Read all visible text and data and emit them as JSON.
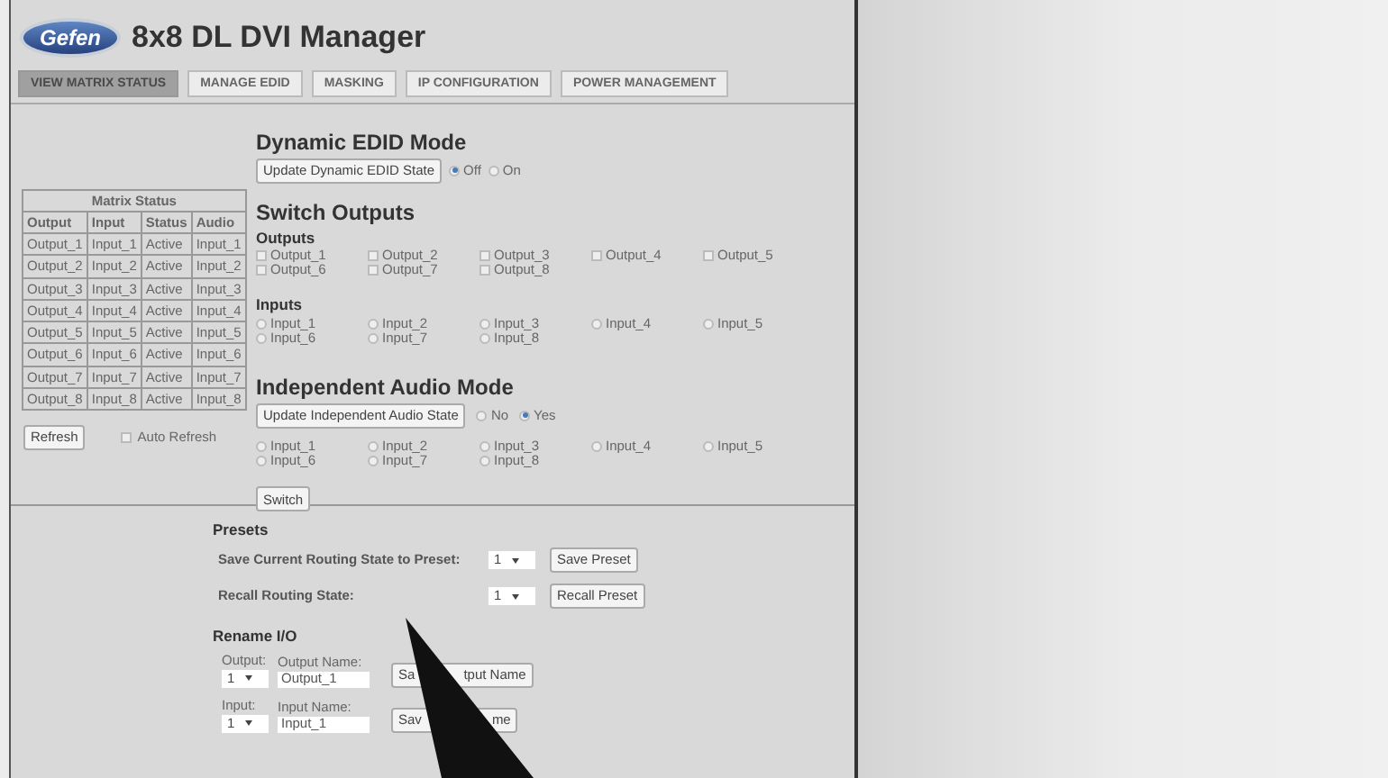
{
  "header": {
    "logo": "Gefen",
    "title": "8x8 DL DVI Manager"
  },
  "tabs": [
    {
      "label": "VIEW MATRIX STATUS",
      "selected": true
    },
    {
      "label": "MANAGE EDID",
      "selected": false
    },
    {
      "label": "MASKING",
      "selected": false
    },
    {
      "label": "IP CONFIGURATION",
      "selected": false
    },
    {
      "label": "POWER MANAGEMENT",
      "selected": false
    }
  ],
  "matrix": {
    "title": "Matrix Status",
    "columns": [
      "Output",
      "Input",
      "Status",
      "Audio"
    ],
    "rows": [
      [
        "Output_1",
        "Input_1",
        "Active",
        "Input_1"
      ],
      [
        "Output_2",
        "Input_2",
        "Active",
        "Input_2"
      ],
      [
        "Output_3",
        "Input_3",
        "Active",
        "Input_3"
      ],
      [
        "Output_4",
        "Input_4",
        "Active",
        "Input_4"
      ],
      [
        "Output_5",
        "Input_5",
        "Active",
        "Input_5"
      ],
      [
        "Output_6",
        "Input_6",
        "Active",
        "Input_6"
      ],
      [
        "Output_7",
        "Input_7",
        "Active",
        "Input_7"
      ],
      [
        "Output_8",
        "Input_8",
        "Active",
        "Input_8"
      ]
    ],
    "refresh": "Refresh",
    "auto_refresh": {
      "label": "Auto Refresh",
      "checked": false
    }
  },
  "dynamic_edid": {
    "heading": "Dynamic EDID Mode",
    "button": "Update Dynamic EDID State",
    "options": [
      {
        "label": "Off",
        "selected": true
      },
      {
        "label": "On",
        "selected": false
      }
    ]
  },
  "switch_outputs": {
    "heading": "Switch Outputs",
    "outputs": {
      "label": "Outputs",
      "items": [
        {
          "label": "Output_1",
          "checked": false
        },
        {
          "label": "Output_2",
          "checked": false
        },
        {
          "label": "Output_3",
          "checked": false
        },
        {
          "label": "Output_4",
          "checked": false
        },
        {
          "label": "Output_5",
          "checked": false
        },
        {
          "label": "Output_6",
          "checked": false
        },
        {
          "label": "Output_7",
          "checked": false
        },
        {
          "label": "Output_8",
          "checked": false
        }
      ]
    },
    "inputs": {
      "label": "Inputs",
      "items": [
        {
          "label": "Input_1",
          "selected": false
        },
        {
          "label": "Input_2",
          "selected": false
        },
        {
          "label": "Input_3",
          "selected": false
        },
        {
          "label": "Input_4",
          "selected": false
        },
        {
          "label": "Input_5",
          "selected": false
        },
        {
          "label": "Input_6",
          "selected": false
        },
        {
          "label": "Input_7",
          "selected": false
        },
        {
          "label": "Input_8",
          "selected": false
        }
      ]
    }
  },
  "audio": {
    "heading": "Independent Audio Mode",
    "button": "Update Independent Audio State",
    "options": [
      {
        "label": "No",
        "selected": false
      },
      {
        "label": "Yes",
        "selected": true
      }
    ],
    "inputs": [
      {
        "label": "Input_1",
        "selected": false
      },
      {
        "label": "Input_2",
        "selected": false
      },
      {
        "label": "Input_3",
        "selected": false
      },
      {
        "label": "Input_4",
        "selected": false
      },
      {
        "label": "Input_5",
        "selected": false
      },
      {
        "label": "Input_6",
        "selected": false
      },
      {
        "label": "Input_7",
        "selected": false
      },
      {
        "label": "Input_8",
        "selected": false
      }
    ],
    "switch": "Switch"
  },
  "presets": {
    "heading": "Presets",
    "save": {
      "label": "Save Current Routing State to Preset:",
      "value": "1",
      "button": "Save Preset"
    },
    "recall": {
      "label": "Recall Routing State:",
      "value": "1",
      "button": "Recall Preset"
    }
  },
  "rename": {
    "heading": "Rename I/O",
    "rows": [
      {
        "label": "Output:",
        "value": "1",
        "name_label": "Output Name:",
        "name": "Output_1",
        "button_start": "Sa",
        "button_end": "tput Name"
      },
      {
        "label": "Input:",
        "value": "1",
        "name_label": "Input Name:",
        "name": "Input_1",
        "button_start": "Sav",
        "button_end": "me"
      }
    ]
  }
}
